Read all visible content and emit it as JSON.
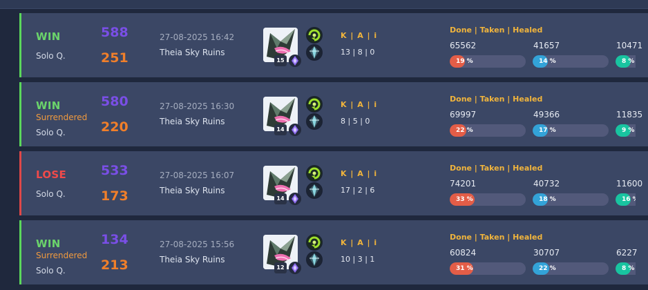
{
  "matches": [
    {
      "result": "WIN",
      "result_class": "win",
      "surrendered": "",
      "queue": "Solo Q.",
      "score_a": "588",
      "score_b": "251",
      "date": "27-08-2025 16:42",
      "map": "Theia Sky Ruins",
      "level": "15",
      "kda_header": "K | A | i",
      "kda": "13 | 8 | 0",
      "stats_header": "Done | Taken | Healed",
      "done": "65562",
      "done_pct": "19 %",
      "done_frac": 0.19,
      "taken": "41657",
      "taken_pct": "14 %",
      "taken_frac": 0.14,
      "healed": "10471",
      "healed_pct": "8 %",
      "healed_frac": 0.08
    },
    {
      "result": "WIN",
      "result_class": "win",
      "surrendered": "Surrendered",
      "queue": "Solo Q.",
      "score_a": "580",
      "score_b": "220",
      "date": "27-08-2025 16:30",
      "map": "Theia Sky Ruins",
      "level": "14",
      "kda_header": "K | A | i",
      "kda": "8 | 5 | 0",
      "stats_header": "Done | Taken | Healed",
      "done": "69997",
      "done_pct": "22 %",
      "done_frac": 0.22,
      "taken": "49366",
      "taken_pct": "17 %",
      "taken_frac": 0.17,
      "healed": "11835",
      "healed_pct": "9 %",
      "healed_frac": 0.09
    },
    {
      "result": "LOSE",
      "result_class": "lose",
      "surrendered": "",
      "queue": "Solo Q.",
      "score_a": "533",
      "score_b": "173",
      "date": "27-08-2025 16:07",
      "map": "Theia Sky Ruins",
      "level": "14",
      "kda_header": "K | A | i",
      "kda": "17 | 2 | 6",
      "stats_header": "Done | Taken | Healed",
      "done": "74201",
      "done_pct": "33 %",
      "done_frac": 0.33,
      "taken": "40732",
      "taken_pct": "18 %",
      "taken_frac": 0.18,
      "healed": "11600",
      "healed_pct": "16 %",
      "healed_frac": 0.16
    },
    {
      "result": "WIN",
      "result_class": "win",
      "surrendered": "Surrendered",
      "queue": "Solo Q.",
      "score_a": "134",
      "score_b": "213",
      "date": "27-08-2025 15:56",
      "map": "Theia Sky Ruins",
      "level": "12",
      "kda_header": "K | A | i",
      "kda": "10 | 3 | 1",
      "stats_header": "Done | Taken | Healed",
      "done": "60824",
      "done_pct": "31 %",
      "done_frac": 0.31,
      "taken": "30707",
      "taken_pct": "22 %",
      "taken_frac": 0.22,
      "healed": "6227",
      "healed_pct": "8 %",
      "healed_frac": 0.08
    }
  ],
  "icons": {
    "champion": "champion-portrait-icon",
    "rune": "rune-icon",
    "spell_1": "summoner-spell-icon",
    "spell_2": "summoner-spell-icon"
  },
  "colors": {
    "win": "#6bd46b",
    "lose": "#f04a4a",
    "surrendered": "#f09a3e",
    "score_primary": "#7a4fe6",
    "score_secondary": "#f07f2a",
    "accent": "#f0b43c",
    "done": "#e35d47",
    "taken": "#33a3d8",
    "healed": "#18c4a0"
  }
}
